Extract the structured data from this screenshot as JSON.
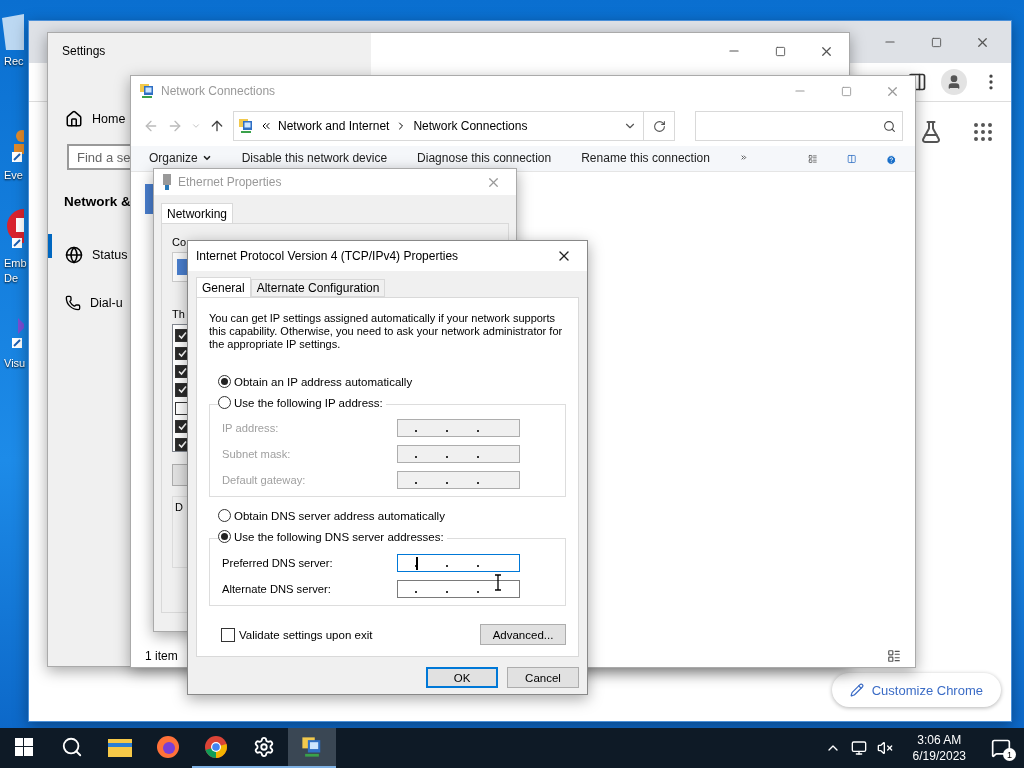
{
  "desktop": {
    "icons": [
      {
        "kind": "bin",
        "lines": [
          "Rec"
        ]
      },
      {
        "kind": "person",
        "lines": [
          "Eve"
        ]
      },
      {
        "kind": "red",
        "lines": [
          "Emb",
          "De"
        ]
      },
      {
        "kind": "purple",
        "lines": [
          "Visu"
        ]
      }
    ]
  },
  "chrome": {
    "customize_button": "Customize Chrome"
  },
  "settings": {
    "title": "Settings",
    "home": "Home",
    "search": {
      "placeholder": "Find a se"
    },
    "section": "Network &",
    "items": [
      {
        "kind": "globe",
        "label": "Status",
        "selected": true
      },
      {
        "kind": "phone",
        "label": "Dial-u",
        "selected": false
      }
    ]
  },
  "explorer": {
    "title": "Network Connections",
    "breadcrumb": [
      "Network and Internet",
      "Network Connections"
    ],
    "commands": [
      {
        "label": "Organize",
        "menu": true
      },
      {
        "label": "Disable this network device",
        "menu": false
      },
      {
        "label": "Diagnose this connection",
        "menu": false
      },
      {
        "label": "Rename this connection",
        "menu": false
      }
    ],
    "status": "1 item"
  },
  "ethernet": {
    "title": "Ethernet Properties",
    "tab": "Networking",
    "connect_label": "Co",
    "list_label": "Th",
    "components": [
      {
        "checked": true
      },
      {
        "checked": true
      },
      {
        "checked": true
      },
      {
        "checked": true
      },
      {
        "checked": false
      },
      {
        "checked": true
      },
      {
        "checked": true
      }
    ],
    "group_label": "D"
  },
  "ipv4": {
    "title": "Internet Protocol Version 4 (TCP/IPv4) Properties",
    "tabs": [
      {
        "label": "General",
        "selected": true
      },
      {
        "label": "Alternate Configuration",
        "selected": false
      }
    ],
    "description": "You can get IP settings assigned automatically if your network supports this capability. Otherwise, you need to ask your network administrator for the appropriate IP settings.",
    "ip_options": [
      {
        "label": "Obtain an IP address automatically",
        "selected": true
      },
      {
        "label": "Use the following IP address:",
        "selected": false
      }
    ],
    "ip_fields": [
      {
        "label": "IP address:",
        "disabled": true,
        "focused": false
      },
      {
        "label": "Subnet mask:",
        "disabled": true,
        "focused": false
      },
      {
        "label": "Default gateway:",
        "disabled": true,
        "focused": false
      }
    ],
    "dns_options": [
      {
        "label": "Obtain DNS server address automatically",
        "selected": false
      },
      {
        "label": "Use the following DNS server addresses:",
        "selected": true
      }
    ],
    "dns_fields": [
      {
        "label": "Preferred DNS server:",
        "disabled": false,
        "focused": true
      },
      {
        "label": "Alternate DNS server:",
        "disabled": false,
        "focused": false
      }
    ],
    "validate": {
      "label": "Validate settings upon exit",
      "checked": false
    },
    "advanced": "Advanced...",
    "ok": "OK",
    "cancel": "Cancel"
  },
  "taskbar": {
    "apps": [
      {
        "kind": "search",
        "running": false,
        "selected": false
      },
      {
        "kind": "folder",
        "running": false,
        "selected": false
      },
      {
        "kind": "firefox",
        "running": false,
        "selected": false
      },
      {
        "kind": "chrome",
        "running": true,
        "selected": false
      },
      {
        "kind": "gear",
        "running": true,
        "selected": false
      },
      {
        "kind": "network",
        "running": true,
        "selected": true
      }
    ],
    "time": "3:06 AM",
    "date": "6/19/2023",
    "notifications": "1"
  }
}
